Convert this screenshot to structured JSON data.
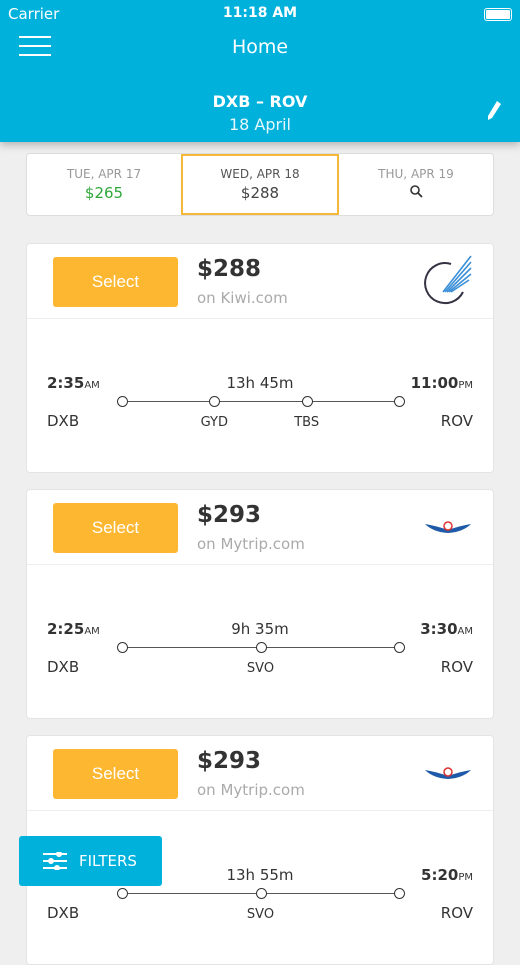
{
  "status": {
    "carrier": "Carrier",
    "time": "11:18 AM"
  },
  "header": {
    "title": "Home",
    "route": "DXB – ROV",
    "date": "18 April"
  },
  "dates": [
    {
      "label": "TUE, APR 17",
      "price": "$265"
    },
    {
      "label": "WED, APR 18",
      "price": "$288",
      "selected": true
    },
    {
      "label": "THU, APR 19",
      "icon": "search-icon"
    }
  ],
  "flights": [
    {
      "select": "Select",
      "price": "$288",
      "via": "on Kiwi.com",
      "airline_icon": "wing-logo",
      "dep_time": "2:35",
      "dep_ampm": "AM",
      "arr_time": "11:00",
      "arr_ampm": "PM",
      "duration": "13h 45m",
      "from": "DXB",
      "to": "ROV",
      "stops": [
        "GYD",
        "TBS"
      ]
    },
    {
      "select": "Select",
      "price": "$293",
      "via": "on Mytrip.com",
      "airline_icon": "aeroflot-logo",
      "dep_time": "2:25",
      "dep_ampm": "AM",
      "arr_time": "3:30",
      "arr_ampm": "AM",
      "duration": "9h 35m",
      "from": "DXB",
      "to": "ROV",
      "stops": [
        "SVO"
      ]
    },
    {
      "select": "Select",
      "price": "$293",
      "via": "on Mytrip.com",
      "airline_icon": "aeroflot-logo",
      "arr_time": "5:20",
      "arr_ampm": "PM",
      "duration": "13h 55m",
      "from": "DXB",
      "to": "ROV",
      "stops": [
        "SVO"
      ]
    }
  ],
  "filters": {
    "label": "FILTERS"
  },
  "colors": {
    "primary": "#00b1dc",
    "select": "#fdb731",
    "cheaper": "#2ea83a"
  }
}
